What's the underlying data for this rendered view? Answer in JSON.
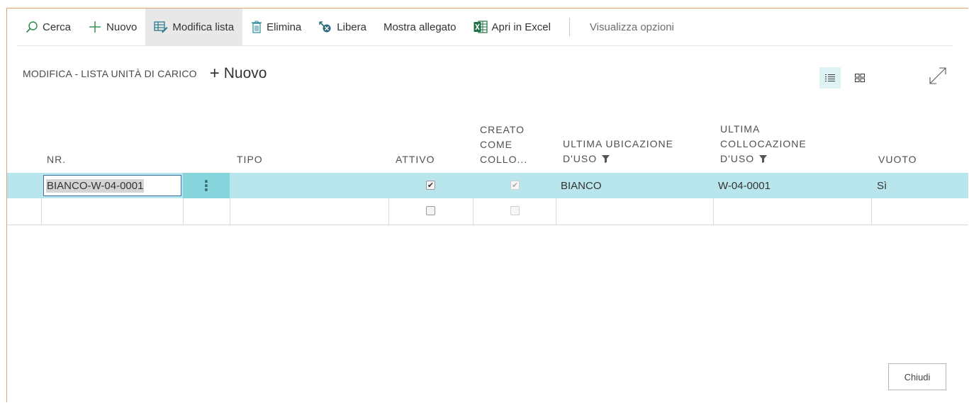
{
  "actionbar": {
    "search": "Cerca",
    "new": "Nuovo",
    "edit_list": "Modifica lista",
    "delete": "Elimina",
    "release": "Libera",
    "show_attachment": "Mostra allegato",
    "open_excel": "Apri in Excel",
    "view_options": "Visualizza opzioni"
  },
  "page": {
    "subtitle": "MODIFICA - LISTA UNITÀ DI CARICO",
    "new_label": "Nuovo"
  },
  "columns": {
    "nr": "NR.",
    "tipo": "TIPO",
    "attivo": "ATTIVO",
    "creato_l1": "CREATO",
    "creato_l2": "COME",
    "creato_l3": "COLLO...",
    "ubic_l1": "ULTIMA UBICAZIONE",
    "ubic_l2": "D'USO",
    "coll_l1": "ULTIMA",
    "coll_l2": "COLLOCAZIONE",
    "coll_l3": "D'USO",
    "vuoto": "VUOTO"
  },
  "rows": [
    {
      "nr": "BIANCO-W-04-0001",
      "tipo": "",
      "attivo": true,
      "creato_come_collo": true,
      "ultima_ubicazione": "BIANCO",
      "ultima_collocazione": "W-04-0001",
      "vuoto": "Sì"
    },
    {
      "nr": "",
      "tipo": "",
      "attivo": false,
      "creato_come_collo": false,
      "ultima_ubicazione": "",
      "ultima_collocazione": "",
      "vuoto": ""
    }
  ],
  "footer": {
    "close": "Chiudi"
  },
  "colors": {
    "accent_border": "#e3a26a",
    "selected_row": "#b9e6ec",
    "row_menu": "#86d4dc",
    "excel_green": "#1e7145"
  }
}
